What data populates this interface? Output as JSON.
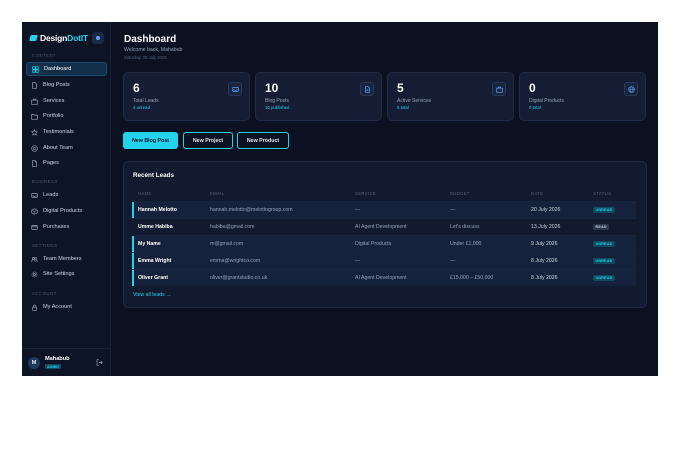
{
  "brand": {
    "name_main": "Design",
    "name_accent": "DotIT"
  },
  "sidebar": {
    "sections": {
      "content": "CONTENT",
      "business": "BUSINESS",
      "settings": "SETTINGS",
      "account": "ACCOUNT"
    },
    "items": [
      {
        "label": "Dashboard",
        "icon": "grid-icon",
        "active": true
      },
      {
        "label": "Blog Posts",
        "icon": "document-icon"
      },
      {
        "label": "Services",
        "icon": "briefcase-icon"
      },
      {
        "label": "Portfolio",
        "icon": "folder-icon"
      },
      {
        "label": "Testimonials",
        "icon": "star-icon"
      },
      {
        "label": "About Team",
        "icon": "globe-icon"
      },
      {
        "label": "Pages",
        "icon": "page-icon"
      },
      {
        "label": "Leads",
        "icon": "inbox-icon"
      },
      {
        "label": "Digital Products",
        "icon": "box-icon"
      },
      {
        "label": "Purchases",
        "icon": "card-icon"
      },
      {
        "label": "Team Members",
        "icon": "users-icon"
      },
      {
        "label": "Site Settings",
        "icon": "gear-icon"
      },
      {
        "label": "My Account",
        "icon": "lock-icon"
      }
    ],
    "user": {
      "initial": "M",
      "name": "Mahabub",
      "role": "ADMIN"
    }
  },
  "header": {
    "title": "Dashboard",
    "welcome": "Welcome back, Mahabub",
    "date": "Saturday, 25 July 2026"
  },
  "stats": [
    {
      "value": "6",
      "label": "Total Leads",
      "sub": "4 unread",
      "icon": "inbox-icon"
    },
    {
      "value": "10",
      "label": "Blog Posts",
      "sub": "10 published",
      "icon": "document-icon"
    },
    {
      "value": "5",
      "label": "Active Services",
      "sub": "5 total",
      "icon": "briefcase-icon"
    },
    {
      "value": "0",
      "label": "Digital Products",
      "sub": "0 total",
      "icon": "globe-icon"
    }
  ],
  "actions": {
    "new_blog_post": "New Blog Post",
    "new_project": "New Project",
    "new_product": "New Product"
  },
  "leads": {
    "title": "Recent Leads",
    "columns": [
      "NAME",
      "EMAIL",
      "SERVICE",
      "BUDGET",
      "DATE",
      "STATUS"
    ],
    "rows": [
      {
        "name": "Hannah Melotto",
        "email": "hannah.melotto@melottogroup.com",
        "service": "—",
        "budget": "—",
        "date": "20 July 2026",
        "status": "UNREAD",
        "unread": true
      },
      {
        "name": "Umme Habiba",
        "email": "habiba@gmail.com",
        "service": "AI Agent Development",
        "budget": "Let's discuss",
        "date": "13 July 2026",
        "status": "READ",
        "unread": false
      },
      {
        "name": "My Name",
        "email": "m@gmail.com",
        "service": "Digital Products",
        "budget": "Under £1,000",
        "date": "9 July 2026",
        "status": "UNREAD",
        "unread": true
      },
      {
        "name": "Emma Wright",
        "email": "emma@wrightco.com",
        "service": "—",
        "budget": "—",
        "date": "8 July 2026",
        "status": "UNREAD",
        "unread": true
      },
      {
        "name": "Oliver Grant",
        "email": "oliver@grantstudio.co.uk",
        "service": "AI Agent Development",
        "budget": "£15,000 – £50,000",
        "date": "8 July 2026",
        "status": "UNREAD",
        "unread": true
      }
    ],
    "view_all": "View all leads →"
  },
  "colors": {
    "accent": "#22d3ee",
    "background": "#0b1120",
    "card": "#141d33"
  }
}
